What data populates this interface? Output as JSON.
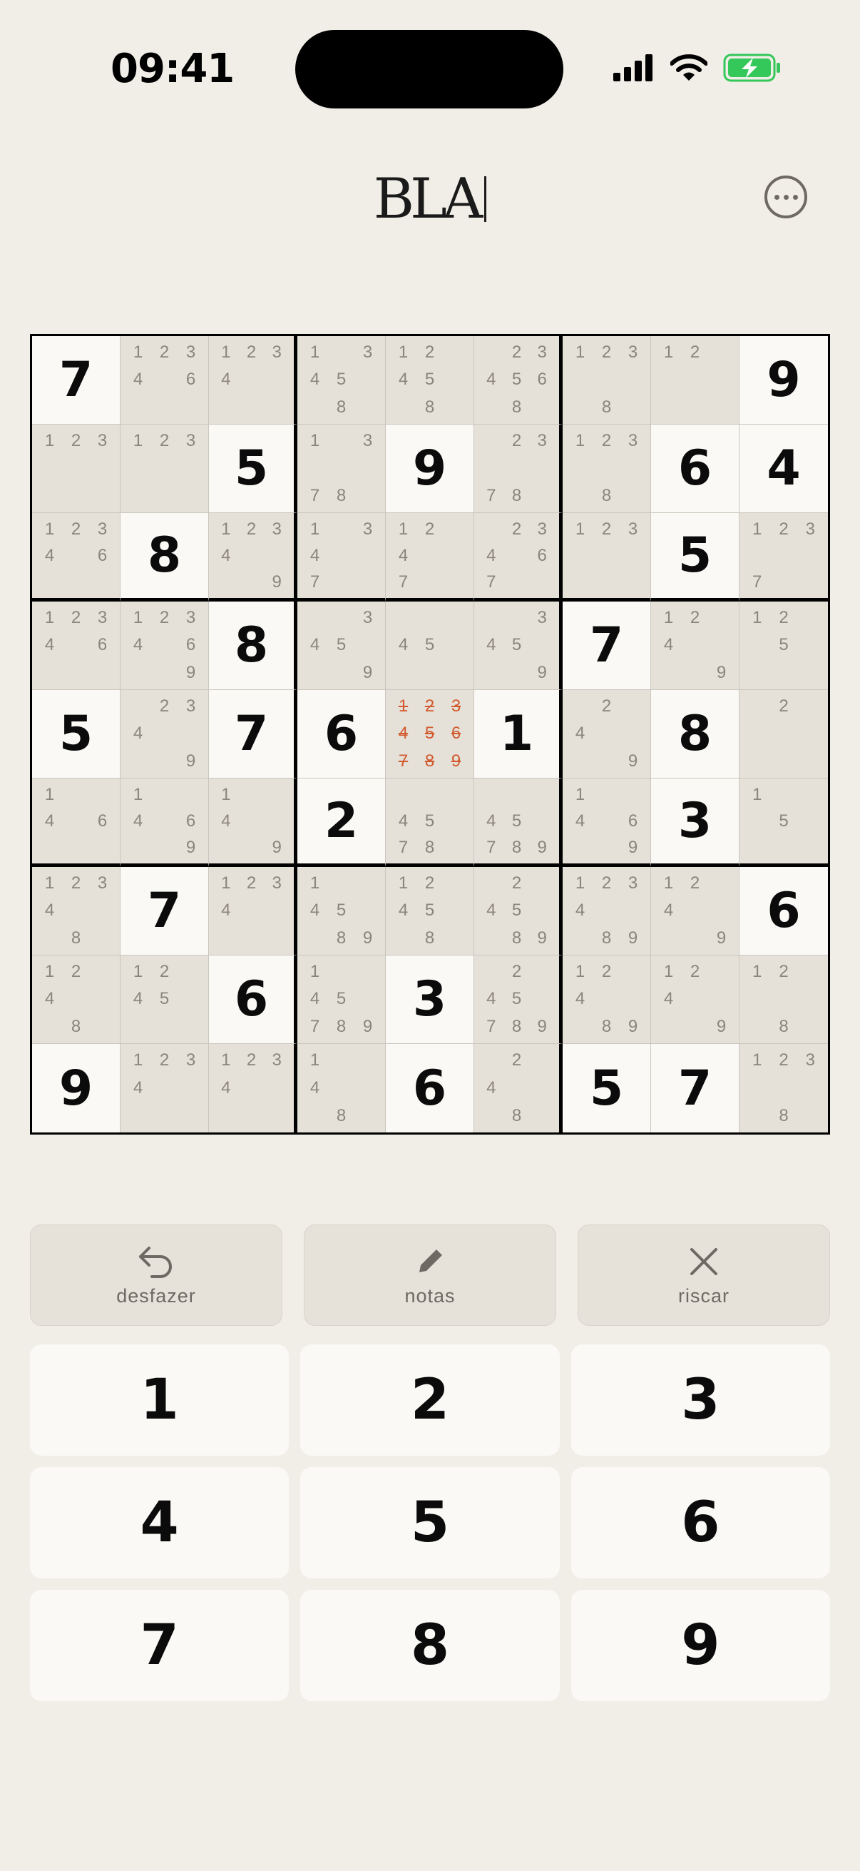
{
  "status_bar": {
    "time": "09:41",
    "icons": [
      "signal-icon",
      "wifi-icon",
      "battery-charging-icon"
    ]
  },
  "header": {
    "logo": "BLA",
    "menu_icon": "more-horizontal-icon"
  },
  "colors": {
    "background": "#f1eee7",
    "given_cell": "#faf9f6",
    "empty_cell": "#e5e1d9",
    "note": "#8a857d",
    "struck_note": "#d25a2e"
  },
  "board": {
    "cells": [
      [
        {
          "v": 7
        },
        {
          "n": [
            1,
            2,
            3,
            4,
            6
          ]
        },
        {
          "n": [
            1,
            2,
            3,
            4
          ]
        },
        {
          "n": [
            1,
            3,
            4,
            5,
            8
          ]
        },
        {
          "n": [
            1,
            2,
            4,
            5,
            8
          ]
        },
        {
          "n": [
            2,
            3,
            4,
            5,
            6,
            8
          ]
        },
        {
          "n": [
            1,
            2,
            3,
            8
          ]
        },
        {
          "n": [
            1,
            2
          ]
        },
        {
          "v": 9
        }
      ],
      [
        {
          "n": [
            1,
            2,
            3
          ]
        },
        {
          "n": [
            1,
            2,
            3
          ]
        },
        {
          "v": 5
        },
        {
          "n": [
            1,
            3,
            7,
            8
          ]
        },
        {
          "v": 9
        },
        {
          "n": [
            2,
            3,
            7,
            8
          ]
        },
        {
          "n": [
            1,
            2,
            3,
            8
          ]
        },
        {
          "v": 6
        },
        {
          "v": 4
        }
      ],
      [
        {
          "n": [
            1,
            2,
            3,
            4,
            6
          ]
        },
        {
          "v": 8
        },
        {
          "n": [
            1,
            2,
            3,
            4,
            9
          ]
        },
        {
          "n": [
            1,
            3,
            4,
            7
          ]
        },
        {
          "n": [
            1,
            2,
            4,
            7
          ]
        },
        {
          "n": [
            2,
            3,
            4,
            6,
            7
          ]
        },
        {
          "n": [
            1,
            2,
            3
          ]
        },
        {
          "v": 5
        },
        {
          "n": [
            1,
            2,
            3,
            7
          ]
        }
      ],
      [
        {
          "n": [
            1,
            2,
            3,
            4,
            6
          ]
        },
        {
          "n": [
            1,
            2,
            3,
            4,
            6,
            9
          ]
        },
        {
          "v": 8
        },
        {
          "n": [
            3,
            4,
            5,
            9
          ]
        },
        {
          "n": [
            4,
            5
          ]
        },
        {
          "n": [
            3,
            4,
            5,
            9
          ]
        },
        {
          "v": 7
        },
        {
          "n": [
            1,
            2,
            4,
            9
          ]
        },
        {
          "n": [
            1,
            2,
            5
          ]
        }
      ],
      [
        {
          "v": 5
        },
        {
          "n": [
            2,
            3,
            4,
            9
          ]
        },
        {
          "v": 7
        },
        {
          "v": 6
        },
        {
          "n": [
            1,
            2,
            3,
            4,
            5,
            6,
            7,
            8,
            9
          ],
          "struck": true
        },
        {
          "v": 1
        },
        {
          "n": [
            2,
            4,
            9
          ]
        },
        {
          "v": 8
        },
        {
          "n": [
            2
          ]
        }
      ],
      [
        {
          "n": [
            1,
            4,
            6
          ]
        },
        {
          "n": [
            1,
            4,
            6,
            9
          ]
        },
        {
          "n": [
            1,
            4,
            9
          ]
        },
        {
          "v": 2
        },
        {
          "n": [
            4,
            5,
            7,
            8
          ]
        },
        {
          "n": [
            4,
            5,
            7,
            8,
            9
          ]
        },
        {
          "n": [
            1,
            4,
            6,
            9
          ]
        },
        {
          "v": 3
        },
        {
          "n": [
            1,
            5
          ]
        }
      ],
      [
        {
          "n": [
            1,
            2,
            3,
            4,
            8
          ]
        },
        {
          "v": 7
        },
        {
          "n": [
            1,
            2,
            3,
            4
          ]
        },
        {
          "n": [
            1,
            4,
            5,
            8,
            9
          ]
        },
        {
          "n": [
            1,
            2,
            4,
            5,
            8
          ]
        },
        {
          "n": [
            2,
            4,
            5,
            8,
            9
          ]
        },
        {
          "n": [
            1,
            2,
            3,
            4,
            8,
            9
          ]
        },
        {
          "n": [
            1,
            2,
            4,
            9
          ]
        },
        {
          "v": 6
        }
      ],
      [
        {
          "n": [
            1,
            2,
            4,
            8
          ]
        },
        {
          "n": [
            1,
            2,
            4,
            5
          ]
        },
        {
          "v": 6
        },
        {
          "n": [
            1,
            4,
            5,
            7,
            8,
            9
          ]
        },
        {
          "v": 3
        },
        {
          "n": [
            2,
            4,
            5,
            7,
            8,
            9
          ]
        },
        {
          "n": [
            1,
            2,
            4,
            8,
            9
          ]
        },
        {
          "n": [
            1,
            2,
            4,
            9
          ]
        },
        {
          "n": [
            1,
            2,
            8
          ]
        }
      ],
      [
        {
          "v": 9
        },
        {
          "n": [
            1,
            2,
            3,
            4
          ]
        },
        {
          "n": [
            1,
            2,
            3,
            4
          ]
        },
        {
          "n": [
            1,
            4,
            8
          ]
        },
        {
          "v": 6
        },
        {
          "n": [
            2,
            4,
            8
          ]
        },
        {
          "v": 5
        },
        {
          "v": 7
        },
        {
          "n": [
            1,
            2,
            3,
            8
          ]
        }
      ]
    ]
  },
  "tools": [
    {
      "label": "desfazer",
      "icon": "undo-icon"
    },
    {
      "label": "notas",
      "icon": "pencil-icon"
    },
    {
      "label": "riscar",
      "icon": "close-icon"
    }
  ],
  "keypad": [
    "1",
    "2",
    "3",
    "4",
    "5",
    "6",
    "7",
    "8",
    "9"
  ]
}
